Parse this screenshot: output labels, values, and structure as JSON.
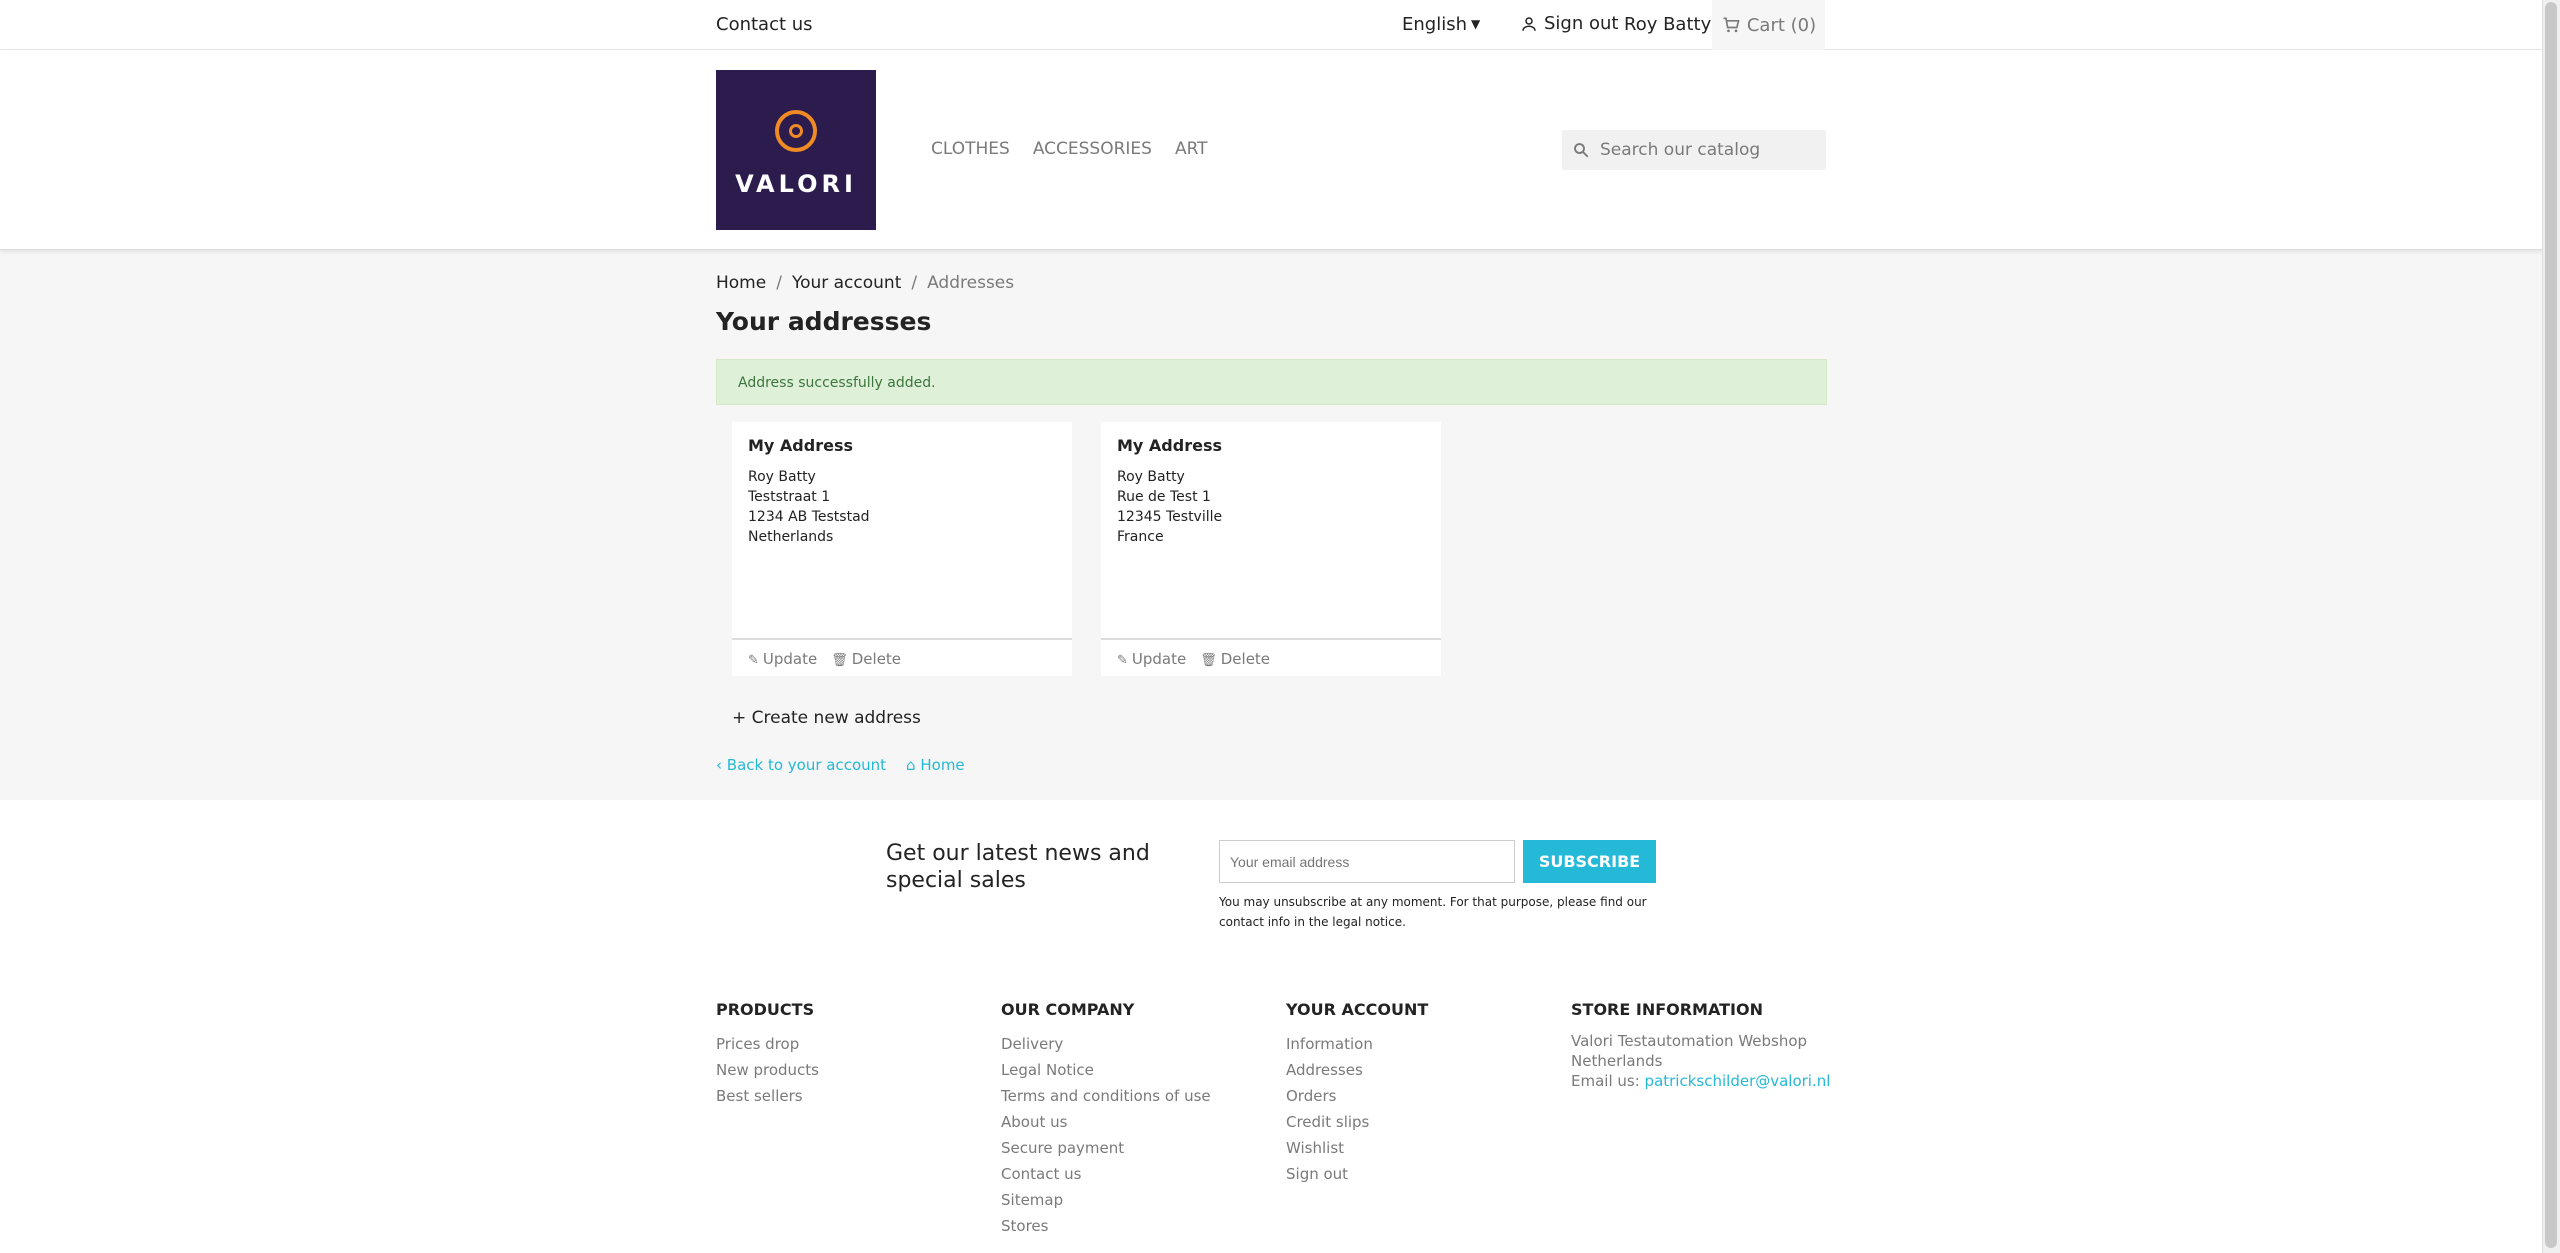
{
  "topbar": {
    "contact": "Contact us",
    "language": "English",
    "signout": "Sign out",
    "username": "Roy Batty",
    "cart": "Cart (0)"
  },
  "header": {
    "logo_text": "VALORI",
    "menu": [
      "CLOTHES",
      "ACCESSORIES",
      "ART"
    ],
    "search_placeholder": "Search our catalog"
  },
  "breadcrumb": [
    "Home",
    "Your account",
    "Addresses"
  ],
  "page_title": "Your addresses",
  "alert": "Address successfully added.",
  "addresses": [
    {
      "title": "My Address",
      "lines": [
        "Roy Batty",
        "Teststraat 1",
        "1234 AB Teststad",
        "Netherlands"
      ],
      "update": "Update",
      "delete": "Delete"
    },
    {
      "title": "My Address",
      "lines": [
        "Roy Batty",
        "Rue de Test 1",
        "12345 Testville",
        "France"
      ],
      "update": "Update",
      "delete": "Delete"
    }
  ],
  "create_address": "Create new address",
  "back_links": {
    "account": "Back to your account",
    "home": "Home"
  },
  "newsletter": {
    "title": "Get our latest news and special sales",
    "placeholder": "Your email address",
    "button": "SUBSCRIBE",
    "note": "You may unsubscribe at any moment. For that purpose, please find our contact info in the legal notice."
  },
  "footer": {
    "products": {
      "heading": "PRODUCTS",
      "items": [
        "Prices drop",
        "New products",
        "Best sellers"
      ]
    },
    "company": {
      "heading": "OUR COMPANY",
      "items": [
        "Delivery",
        "Legal Notice",
        "Terms and conditions of use",
        "About us",
        "Secure payment",
        "Contact us",
        "Sitemap",
        "Stores"
      ]
    },
    "account": {
      "heading": "YOUR ACCOUNT",
      "items": [
        "Information",
        "Addresses",
        "Orders",
        "Credit slips",
        "Wishlist",
        "Sign out"
      ]
    },
    "store": {
      "heading": "STORE INFORMATION",
      "name": "Valori Testautomation Webshop",
      "country": "Netherlands",
      "email_label": "Email us:",
      "email": "patrickschilder@valori.nl"
    }
  },
  "colors": {
    "accent": "#24b9d7",
    "logo_bg": "#2b1c4d",
    "logo_accent": "#f08a24",
    "alert_bg": "#dff0d8"
  }
}
